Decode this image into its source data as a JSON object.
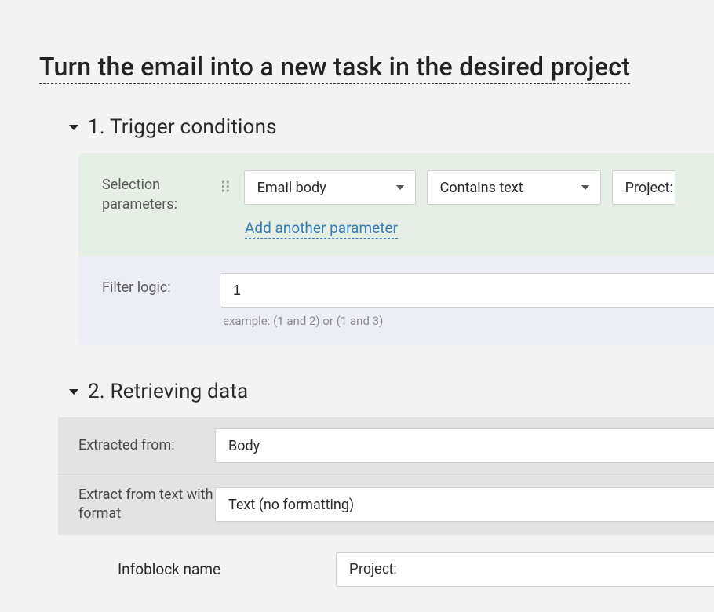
{
  "title": "Turn the email into a new task in the desired project",
  "section1": {
    "heading": "1. Trigger conditions",
    "selection_label": "Selection parameters:",
    "param_source": "Email body",
    "param_operator": "Contains text",
    "param_value": "Project:",
    "add_param_label": "Add another parameter",
    "filter_label": "Filter logic:",
    "filter_value": "1",
    "filter_hint": "example: (1 and 2) or (1 and 3)"
  },
  "section2": {
    "heading": "2. Retrieving data",
    "extracted_from_label": "Extracted from:",
    "extracted_from_value": "Body",
    "format_label": "Extract from text with format",
    "format_value": "Text (no formatting)",
    "infoblock_name_label": "Infoblock name",
    "infoblock_name_value": "Project:"
  }
}
